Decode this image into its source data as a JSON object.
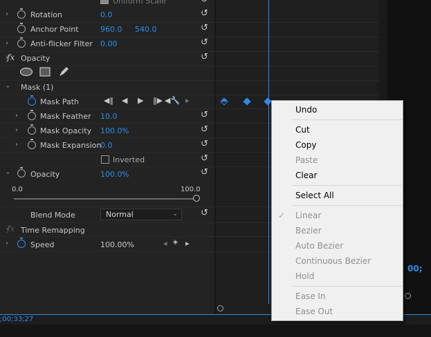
{
  "effect_controls": {
    "uniform_scale_label": "Uniform Scale",
    "rotation": {
      "label": "Rotation",
      "value": "0.0"
    },
    "anchor_point": {
      "label": "Anchor Point",
      "x": "960.0",
      "y": "540.0"
    },
    "anti_flicker": {
      "label": "Anti-flicker Filter",
      "value": "0.00"
    },
    "opacity_group": {
      "fx": "fx",
      "label": "Opacity"
    },
    "mask": {
      "label": "Mask (1)",
      "path_label": "Mask Path",
      "feather": {
        "label": "Mask Feather",
        "value": "10.0"
      },
      "opacity": {
        "label": "Mask Opacity",
        "value": "100.0",
        "unit": "%"
      },
      "expansion": {
        "label": "Mask Expansion",
        "value": "0.0"
      },
      "inverted_label": "Inverted"
    },
    "opacity": {
      "label": "Opacity",
      "value": "100.0",
      "unit": "%",
      "slider_min": "0.0",
      "slider_max": "100.0",
      "slider_fraction": 1.0
    },
    "blend_mode": {
      "label": "Blend Mode",
      "value": "Normal"
    },
    "time_remapping": {
      "fx": "fx",
      "label": "Time Remapping"
    },
    "speed": {
      "label": "Speed",
      "value": "100.00%"
    }
  },
  "timecode_bottom": ";00;33;27",
  "timecode_right": "00;",
  "context_menu": {
    "undo": "Undo",
    "cut": "Cut",
    "copy": "Copy",
    "paste": "Paste",
    "clear": "Clear",
    "select_all": "Select All",
    "linear": "Linear",
    "bezier": "Bezier",
    "auto_bezier": "Auto Bezier",
    "continuous_bezier": "Continuous Bezier",
    "hold": "Hold",
    "ease_in": "Ease In",
    "ease_out": "Ease Out"
  },
  "colors": {
    "accent": "#2d8ceb",
    "panel": "#232323",
    "menu": "#f0f0f0"
  }
}
